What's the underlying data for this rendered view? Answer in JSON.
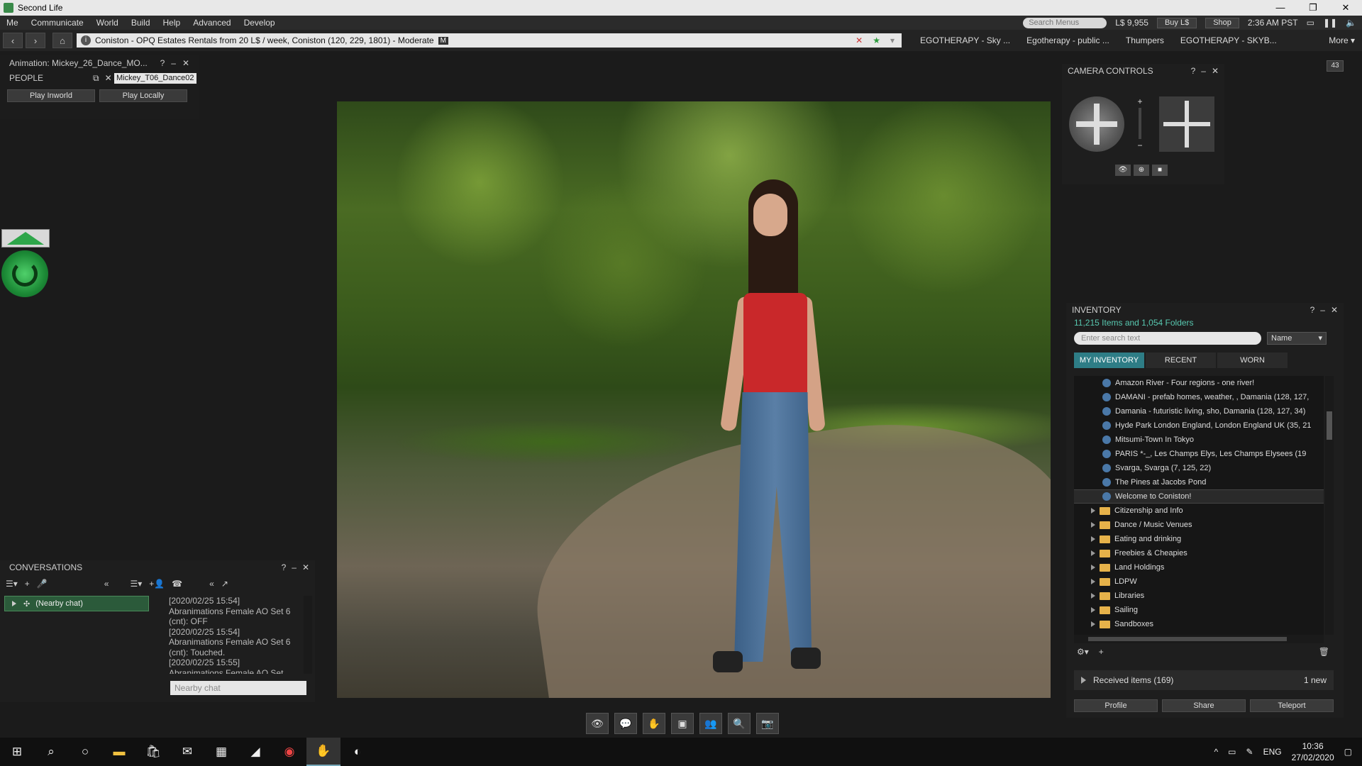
{
  "window": {
    "title": "Second Life",
    "minimize": "—",
    "restore": "❐",
    "close": "✕"
  },
  "menubar": {
    "items": [
      "Me",
      "Communicate",
      "World",
      "Build",
      "Help",
      "Advanced",
      "Develop"
    ],
    "search_placeholder": "Search Menus",
    "balance": "L$ 9,955",
    "buy_label": "Buy L$",
    "shop_label": "Shop",
    "time": "2:36 AM PST"
  },
  "navbar": {
    "location": "Coniston - OPQ Estates Rentals from 20 L$ / week, Coniston (120, 229, 1801) - Moderate",
    "maturity": "M",
    "favorites": [
      "EGOTHERAPY - Sky ...",
      "Egotherapy - public ...",
      "Thumpers",
      "EGOTHERAPY - SKYB..."
    ],
    "more_label": "More ▾"
  },
  "animation_panel": {
    "title": "Animation: Mickey_26_Dance_MO...",
    "people_label": "PEOPLE",
    "anim_value": "Mickey_T06_Dance02",
    "play_inworld": "Play Inworld",
    "play_locally": "Play Locally"
  },
  "camera_panel": {
    "title": "CAMERA CONTROLS",
    "zoom_plus": "+",
    "zoom_minus": "−"
  },
  "inventory": {
    "title": "INVENTORY",
    "count": "11,215 Items and 1,054 Folders",
    "search_placeholder": "Enter search text",
    "sort": "Name",
    "tabs": [
      "MY INVENTORY",
      "RECENT",
      "WORN"
    ],
    "landmarks": [
      "Amazon River - Four regions - one river!",
      "DAMANI - prefab homes, weather, , Damania (128, 127,",
      "Damania - futuristic living, sho, Damania (128, 127, 34)",
      "Hyde Park London England, London England UK (35, 21",
      "Mitsumi-Town In Tokyo",
      "PARIS      *-_, Les Champs Elys, Les Champs Elysees (19",
      "Svarga, Svarga (7, 125, 22)",
      "The Pines at Jacobs Pond",
      "Welcome to Coniston!"
    ],
    "folders": [
      "Citizenship and Info",
      "Dance / Music Venues",
      "Eating and drinking",
      "Freebies & Cheapies",
      "Land Holdings",
      "LDPW",
      "Libraries",
      "Sailing",
      "Sandboxes"
    ],
    "received": "Received items (169)",
    "received_new": "1 new",
    "buttons": [
      "Profile",
      "Share",
      "Teleport"
    ]
  },
  "conversations": {
    "title": "CONVERSATIONS",
    "nearby": "(Nearby chat)",
    "log": [
      "[2020/02/25 15:54]",
      "Abranimations Female AO Set 6 (cnt): OFF",
      "[2020/02/25 15:54]",
      "Abranimations Female AO Set 6 (cnt): Touched.",
      "[2020/02/25 15:55]",
      "Abranimations Female AO Set"
    ],
    "input_placeholder": "Nearby chat"
  },
  "mini_badge": "43",
  "taskbar": {
    "lang": "ENG",
    "time": "10:36",
    "date": "27/02/2020"
  }
}
